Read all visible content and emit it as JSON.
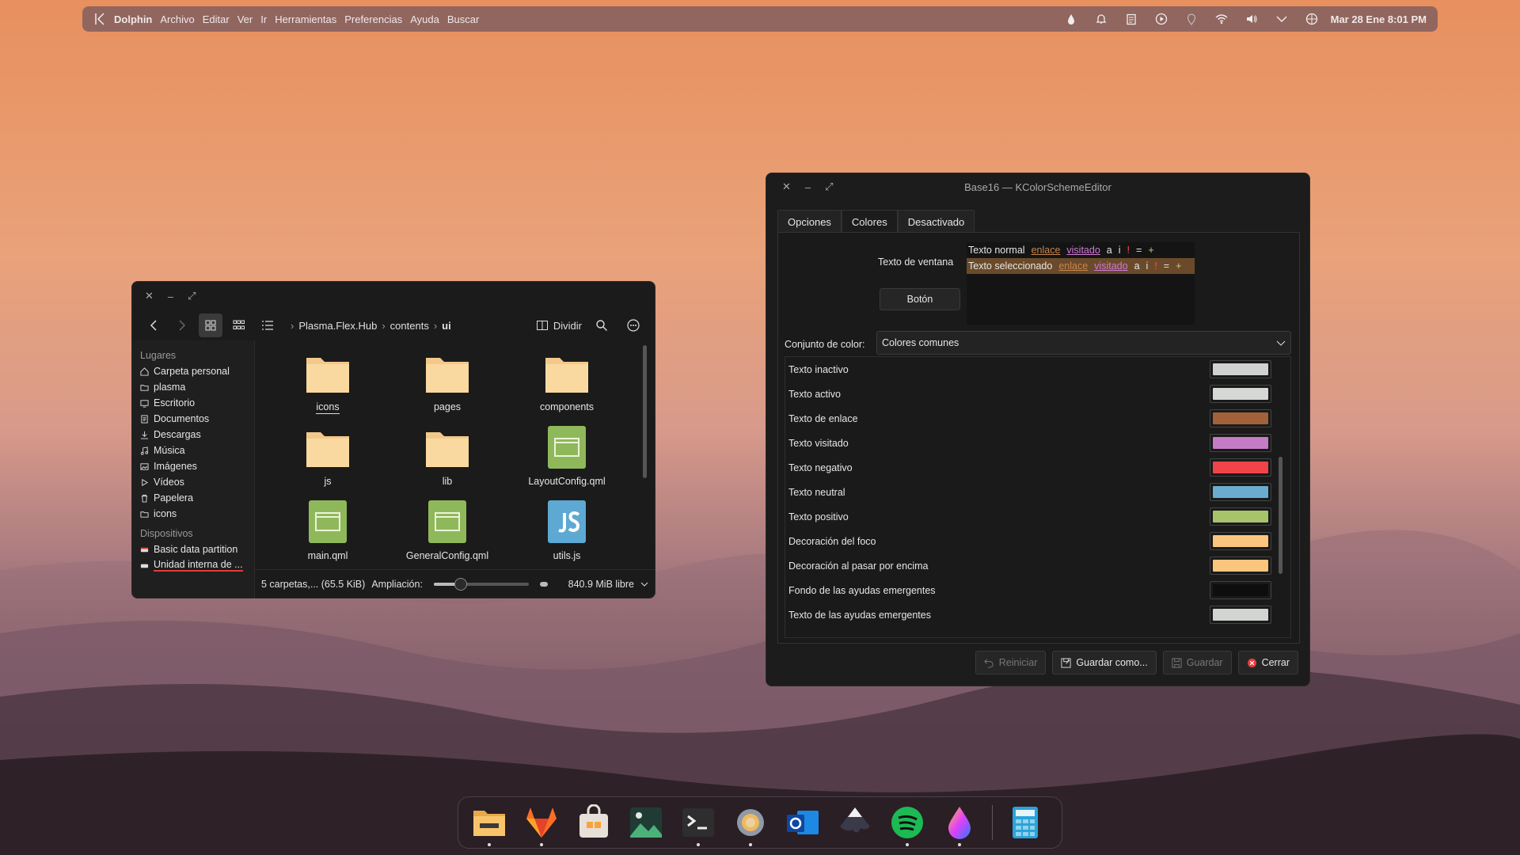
{
  "topbar": {
    "app_name": "Dolphin",
    "menus": [
      "Archivo",
      "Editar",
      "Ver",
      "Ir",
      "Herramientas",
      "Preferencias",
      "Ayuda",
      "Buscar"
    ],
    "clock": "Mar 28 Ene  8:01 PM"
  },
  "dolphin": {
    "breadcrumb": [
      "Plasma.Flex.Hub",
      "contents",
      "ui"
    ],
    "split_label": "Dividir",
    "places_header": "Lugares",
    "places": [
      {
        "label": "Carpeta personal",
        "icon": "home-icon"
      },
      {
        "label": "plasma",
        "icon": "folder-icon"
      },
      {
        "label": "Escritorio",
        "icon": "desktop-icon"
      },
      {
        "label": "Documentos",
        "icon": "documents-icon"
      },
      {
        "label": "Descargas",
        "icon": "download-icon"
      },
      {
        "label": "Música",
        "icon": "music-icon"
      },
      {
        "label": "Imágenes",
        "icon": "image-icon"
      },
      {
        "label": "Vídeos",
        "icon": "video-icon"
      },
      {
        "label": "Papelera",
        "icon": "trash-icon"
      },
      {
        "label": "icons",
        "icon": "folder-icon"
      }
    ],
    "devices_header": "Dispositivos",
    "devices": [
      {
        "label": "Basic data partition",
        "icon": "drive-icon"
      },
      {
        "label": "Unidad interna de ...",
        "icon": "drive-icon"
      }
    ],
    "files": [
      {
        "label": "icons",
        "type": "folder"
      },
      {
        "label": "pages",
        "type": "folder"
      },
      {
        "label": "components",
        "type": "folder"
      },
      {
        "label": "js",
        "type": "folder"
      },
      {
        "label": "lib",
        "type": "folder"
      },
      {
        "label": "LayoutConfig.qml",
        "type": "qml"
      },
      {
        "label": "main.qml",
        "type": "qml"
      },
      {
        "label": "GeneralConfig.qml",
        "type": "qml"
      },
      {
        "label": "utils.js",
        "type": "js"
      }
    ],
    "status_summary": "5 carpetas,... (65.5 KiB)",
    "zoom_label": "Ampliación:",
    "free_space": "840.9 MiB libre"
  },
  "editor": {
    "title": "Base16 — KColorSchemeEditor",
    "tabs": [
      "Opciones",
      "Colores",
      "Desactivado"
    ],
    "active_tab": "Colores",
    "preview_label": "Texto de ventana",
    "preview_normal": "Texto normal",
    "preview_selected": "Texto seleccionado",
    "preview_link": "enlace",
    "preview_visited": "visitado",
    "preview_a": "a",
    "preview_i": "i",
    "preview_neg": "!",
    "preview_eq": "=",
    "preview_plus": "+",
    "preview_button": "Botón",
    "scheme_label": "Conjunto de color:",
    "scheme_value": "Colores comunes",
    "colors": [
      {
        "label": "Texto inactivo",
        "color": "#cfd2d0"
      },
      {
        "label": "Texto activo",
        "color": "#d6d8d6"
      },
      {
        "label": "Texto de enlace",
        "color": "#a0613b"
      },
      {
        "label": "Texto visitado",
        "color": "#c57cc6"
      },
      {
        "label": "Texto negativo",
        "color": "#f04448"
      },
      {
        "label": "Texto neutral",
        "color": "#6aaccf"
      },
      {
        "label": "Texto positivo",
        "color": "#a8c46a"
      },
      {
        "label": "Decoración del foco",
        "color": "#fcc57e"
      },
      {
        "label": "Decoración al pasar por encima",
        "color": "#fcc57e"
      },
      {
        "label": "Fondo de las ayudas emergentes",
        "color": "#0e0e0e"
      },
      {
        "label": "Texto de las ayudas emergentes",
        "color": "#d2d4d2"
      }
    ],
    "buttons": {
      "reset": "Reiniciar",
      "save_as": "Guardar como...",
      "save": "Guardar",
      "close": "Cerrar"
    }
  }
}
